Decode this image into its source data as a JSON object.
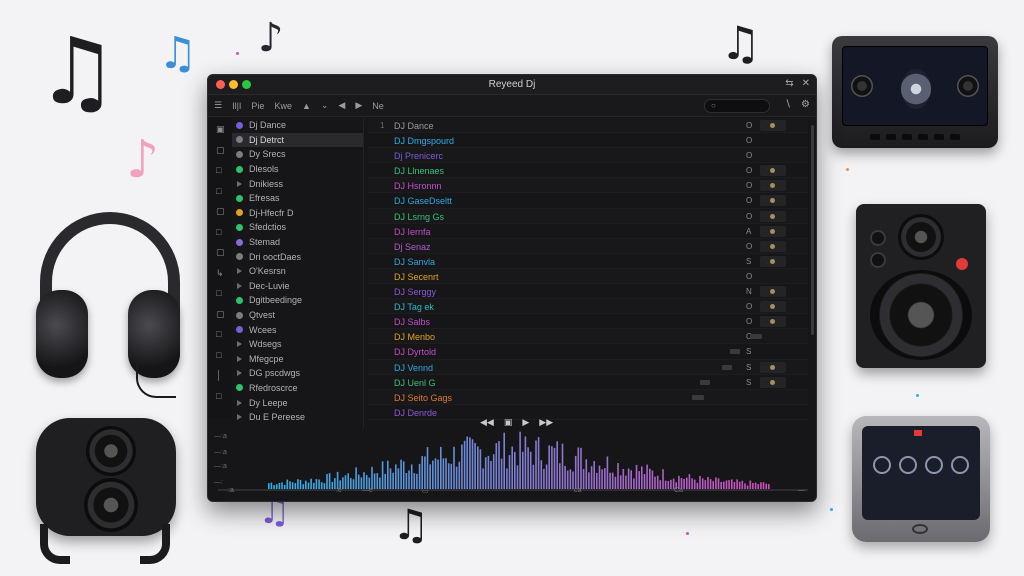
{
  "window": {
    "title": "Reyeed Dj",
    "controls": [
      "⇆",
      "✕"
    ],
    "traffic_colors": [
      "#ff5f57",
      "#febc2e",
      "#28c840"
    ]
  },
  "toolbar": {
    "items": [
      "☰",
      "Il|I",
      "Pie",
      "Kwe",
      "▲",
      "⌄",
      "◀",
      "▶",
      "Ne"
    ],
    "search_icon": "○",
    "right_icons": [
      "∖",
      "⚙"
    ]
  },
  "iconstrip": [
    "▣",
    "▢",
    "□",
    "□",
    "▢",
    "□",
    "▢",
    "↳",
    "□",
    "▢",
    "□",
    "□",
    "│",
    "□"
  ],
  "sidebar": {
    "items": [
      {
        "label": "Dj Dance",
        "dot": "#7a5cd6",
        "selected": false
      },
      {
        "label": "Dj Detrct",
        "dot": "#7c7c82",
        "selected": true
      },
      {
        "label": "Dy Srecs",
        "dot": "#7c7c82",
        "selected": false
      },
      {
        "label": "Dlesols",
        "dot": "#2ec26a",
        "selected": false
      },
      {
        "label": "Dnikiess",
        "dot": null,
        "selected": false
      },
      {
        "label": "Efresas",
        "dot": "#2ec26a",
        "selected": false
      },
      {
        "label": "Dj-Hfecfr D",
        "dot": "#e0a41f",
        "selected": false
      },
      {
        "label": "Sfedctios",
        "dot": "#2ec26a",
        "selected": false
      },
      {
        "label": "Stemad",
        "dot": "#8a6ad8",
        "selected": false
      },
      {
        "label": "Dri ooctDaes",
        "dot": "#7c7c82",
        "selected": false
      },
      {
        "label": "O'Kesrsn",
        "dot": null,
        "selected": false
      },
      {
        "label": "Dec-Luvie",
        "dot": null,
        "selected": false
      },
      {
        "label": "Dgitbeedinge",
        "dot": "#2ec26a",
        "selected": false
      },
      {
        "label": "Qtvest",
        "dot": "#7c7c82",
        "selected": false
      },
      {
        "label": "Wcees",
        "dot": "#7a5cd6",
        "selected": false
      },
      {
        "label": "Wdsegs",
        "dot": null,
        "selected": false
      },
      {
        "label": "Mfegcpe",
        "dot": null,
        "selected": false
      },
      {
        "label": "DG pscdwgs",
        "dot": null,
        "selected": false
      },
      {
        "label": "Rfedroscrce",
        "dot": "#2ec26a",
        "selected": false
      },
      {
        "label": "Dy Leepe",
        "dot": null,
        "selected": false
      },
      {
        "label": "Du E Pereese",
        "dot": null,
        "selected": false
      }
    ]
  },
  "tracks": [
    {
      "n": "1",
      "name": "DJ Dance",
      "color": "#9a9aa0",
      "o": "O",
      "btn": true
    },
    {
      "n": "",
      "name": "DJ Dmgspourd",
      "color": "#2fb0e6",
      "o": "O",
      "btn": false
    },
    {
      "n": "",
      "name": "Dj Prenicerc",
      "color": "#7a5cd6",
      "o": "O",
      "btn": false
    },
    {
      "n": "",
      "name": "DJ Llnenaes",
      "color": "#35c47a",
      "o": "O",
      "btn": true
    },
    {
      "n": "",
      "name": "DJ Hsronnn",
      "color": "#c050c8",
      "o": "O",
      "btn": true
    },
    {
      "n": "",
      "name": "DJ GaseDseltt",
      "color": "#2fa8e0",
      "o": "O",
      "btn": true
    },
    {
      "n": "",
      "name": "DJ Lsrng Gs",
      "color": "#35c47a",
      "o": "O",
      "btn": true
    },
    {
      "n": "",
      "name": "DJ Iernfa",
      "color": "#c050c8",
      "o": "A",
      "btn": true
    },
    {
      "n": "",
      "name": "Dj Senaz",
      "color": "#b05acd",
      "o": "O",
      "btn": true
    },
    {
      "n": "",
      "name": "DJ Sanvla",
      "color": "#2fa8e0",
      "o": "S",
      "btn": true
    },
    {
      "n": "",
      "name": "DJ Secenrt",
      "color": "#e0a41f",
      "o": "O",
      "btn": false
    },
    {
      "n": "",
      "name": "DJ Serggy",
      "color": "#8e58d6",
      "o": "N",
      "btn": true
    },
    {
      "n": "",
      "name": "DJ Tag ek",
      "color": "#2fb8c8",
      "o": "O",
      "btn": true
    },
    {
      "n": "",
      "name": "DJ Salbs",
      "color": "#c050c8",
      "o": "O",
      "btn": true
    },
    {
      "n": "",
      "name": "DJ Menbo",
      "color": "#e0a41f",
      "o": "O",
      "btn": false
    },
    {
      "n": "",
      "name": "DJ Dyrtold",
      "color": "#c050c8",
      "o": "S",
      "btn": false
    },
    {
      "n": "",
      "name": "DJ Vennd",
      "color": "#2fa8e0",
      "o": "S",
      "btn": true
    },
    {
      "n": "",
      "name": "DJ Uenl G",
      "color": "#35c47a",
      "o": "S",
      "btn": true
    },
    {
      "n": "",
      "name": "DJ Seito Gags",
      "color": "#e07a30",
      "o": "",
      "btn": false
    },
    {
      "n": "",
      "name": "DJ Denrde",
      "color": "#8e58d6",
      "o": "",
      "btn": false
    }
  ],
  "transport": [
    "◀◀",
    "▣",
    "▶",
    "▶▶"
  ],
  "wave_ticks": [
    "—:a",
    "—:a",
    "—:a",
    "—:"
  ],
  "bottom_labels": [
    ":a",
    ":e",
    "—e",
    "▭",
    "ca",
    "Ca",
    "—"
  ],
  "colors": {
    "accent_blue": "#2fb0e6",
    "accent_purple": "#7a5cd6",
    "accent_pink": "#d14fc0"
  }
}
